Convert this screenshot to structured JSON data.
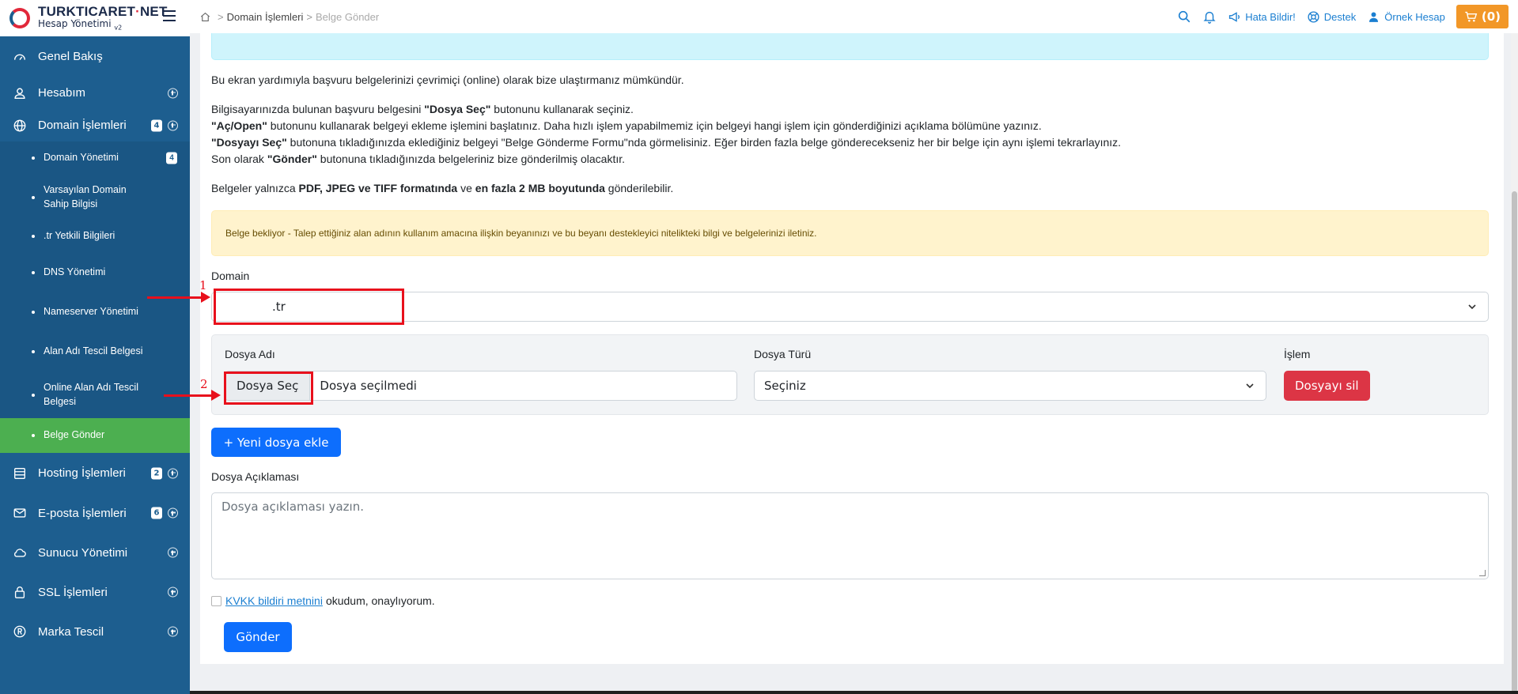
{
  "brand": {
    "name_main": "TURKTICARET",
    "name_dot": "·",
    "name_suffix": "NET",
    "subtitle": "Hesap Yönetimi",
    "version": "v2"
  },
  "sidebar": {
    "items": [
      {
        "label": "Genel Bakış",
        "icon": "gauge-icon"
      },
      {
        "label": "Hesabım",
        "icon": "user-icon"
      },
      {
        "label": "Domain İşlemleri",
        "icon": "globe-icon",
        "badge": "4"
      },
      {
        "label": "Hosting İşlemleri",
        "icon": "server-icon",
        "badge": "2"
      },
      {
        "label": "E-posta İşlemleri",
        "icon": "envelope-icon",
        "badge": "6"
      },
      {
        "label": "Sunucu Yönetimi",
        "icon": "cloud-icon"
      },
      {
        "label": "SSL İşlemleri",
        "icon": "lock-icon"
      },
      {
        "label": "Marka Tescil",
        "icon": "registered-icon"
      }
    ],
    "submenu": [
      {
        "label": "Domain Yönetimi",
        "badge": "4"
      },
      {
        "label": "Varsayılan Domain Sahip Bilgisi"
      },
      {
        "label": ".tr Yetkili Bilgileri"
      },
      {
        "label": "DNS Yönetimi"
      },
      {
        "label": "Nameserver Yönetimi"
      },
      {
        "label": "Alan Adı Tescil Belgesi"
      },
      {
        "label": "Online Alan Adı Tescil Belgesi"
      },
      {
        "label": "Belge Gönder",
        "active": true
      }
    ]
  },
  "topbar": {
    "breadcrumb": [
      "Domain İşlemleri",
      "Belge Gönder"
    ],
    "report_bug": "Hata Bildir!",
    "support": "Destek",
    "account": "Örnek Hesap",
    "cart": "(0)"
  },
  "content": {
    "intro": "Bu ekran yardımıyla başvuru belgelerinizi çevrimiçi (online) olarak bize ulaştırmanız mümkündür.",
    "steps": [
      {
        "pre": "Bilgisayarınızda bulunan başvuru belgesini ",
        "bold": "\"Dosya Seç\"",
        "post": " butonunu kullanarak seçiniz."
      },
      {
        "pre": "",
        "bold": "\"Aç/Open\"",
        "post": " butonunu kullanarak belgeyi ekleme işlemini başlatınız. Daha hızlı işlem yapabilmemiz için belgeyi hangi işlem için gönderdiğinizi açıklama bölümüne yazınız."
      },
      {
        "pre": "",
        "bold": "\"Dosyayı Seç\"",
        "post": " butonuna tıkladığınızda eklediğiniz belgeyi \"Belge Gönderme Formu\"nda görmelisiniz. Eğer birden fazla belge gönderecekseniz her bir belge için aynı işlemi tekrarlayınız."
      },
      {
        "pre": "Son olarak ",
        "bold": "\"Gönder\"",
        "post": " butonuna tıkladığınızda belgeleriniz bize gönderilmiş olacaktır."
      }
    ],
    "formats": {
      "pre": "Belgeler yalnızca ",
      "b1": "PDF, JPEG ve TIFF formatında",
      "mid": " ve ",
      "b2": "en fazla 2 MB boyutunda",
      "post": " gönderilebilir."
    },
    "warning": "Belge bekliyor - Talep ettiğiniz alan adının kullanım amacına ilişkin beyanınızı ve bu beyanı destekleyici nitelikteki bilgi ve belgelerinizi iletiniz.",
    "domain_label": "Domain",
    "domain_value": ".tr",
    "file_name_label": "Dosya Adı",
    "file_type_label": "Dosya Türü",
    "action_label": "İşlem",
    "choose_file": "Dosya Seç",
    "no_file": "Dosya seçilmedi",
    "type_placeholder": "Seçiniz",
    "delete_file": "Dosyayı sil",
    "add_file": "+ Yeni dosya ekle",
    "desc_label": "Dosya Açıklaması",
    "desc_placeholder": "Dosya açıklaması yazın.",
    "kvkk_link": "KVKK bildiri metnini",
    "kvkk_text": "okudum, onaylıyorum.",
    "submit": "Gönder"
  },
  "annotations": {
    "one": "1",
    "two": "2"
  },
  "colors": {
    "sidebar": "#1d5e8f",
    "active": "#4caf50",
    "primary": "#0d6efd",
    "danger": "#dc3545",
    "cart": "#f29727",
    "annotation": "#e8101c"
  }
}
